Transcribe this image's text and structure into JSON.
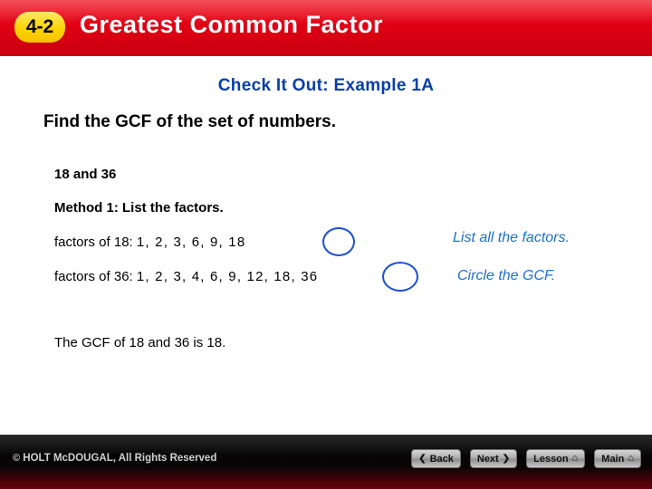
{
  "banner": {
    "lesson_number": "4-2",
    "title": "Greatest Common Factor"
  },
  "slide": {
    "subtitle": "Check It Out: Example 1A",
    "prompt": "Find the GCF of the set of numbers.",
    "numbers_line": "18 and 36",
    "method_line": "Method 1:  List the factors.",
    "factor_rows": [
      {
        "label": "factors of 18:",
        "list": "1, 2, 3, 6, 9, 18",
        "annotation": "List all the factors."
      },
      {
        "label": "factors of 36:",
        "list": "1, 2, 3, 4, 6, 9, 12, 18, 36",
        "annotation": "Circle the GCF."
      }
    ],
    "conclusion": "The GCF of 18 and 36 is 18."
  },
  "footer": {
    "copyright_mark": "©",
    "copyright_text": " HOLT McDOUGAL, All Rights Reserved",
    "buttons": [
      {
        "label": "Back",
        "glyph": "❮",
        "glyph_side": "left",
        "icon": "chevron-left-icon"
      },
      {
        "label": "Next",
        "glyph": "❯",
        "glyph_side": "right",
        "icon": "chevron-right-icon"
      },
      {
        "label": "Lesson",
        "glyph": "⌂",
        "glyph_side": "right",
        "icon": "home-icon"
      },
      {
        "label": "Main",
        "glyph": "⌂",
        "glyph_side": "right",
        "icon": "home-icon"
      }
    ]
  },
  "colors": {
    "banner_red": "#e00014",
    "badge_yellow": "#ffd800",
    "subtitle_blue": "#0a3fa8",
    "annotation_blue": "#1f6fd0",
    "circle_blue": "#1b4fd8"
  }
}
